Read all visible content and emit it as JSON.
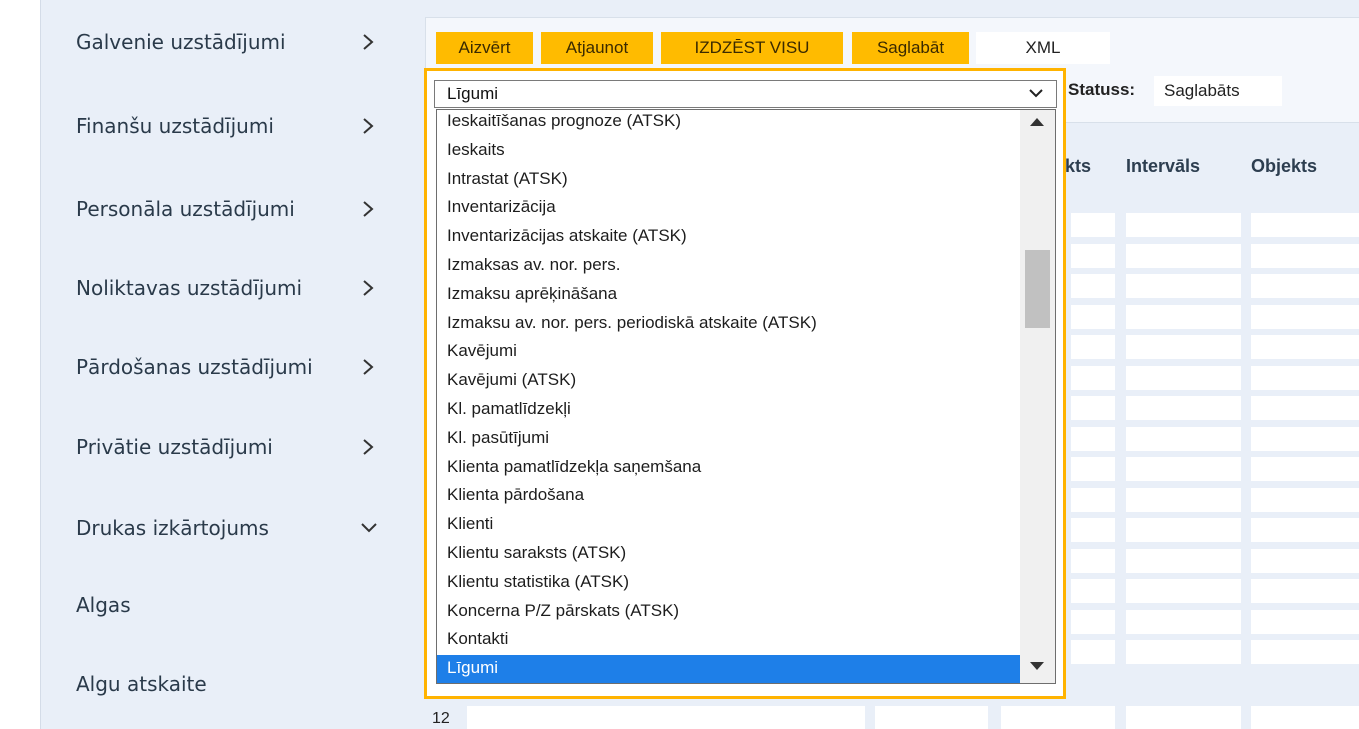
{
  "sidebar": {
    "items": [
      {
        "label": "Galvenie uzstādījumi",
        "icon": "chevron-right-icon"
      },
      {
        "label": "Finanšu uzstādījumi",
        "icon": "chevron-right-icon"
      },
      {
        "label": "Personāla uzstādījumi",
        "icon": "chevron-right-icon"
      },
      {
        "label": "Noliktavas uzstādījumi",
        "icon": "chevron-right-icon"
      },
      {
        "label": "Pārdošanas uzstādījumi",
        "icon": "chevron-right-icon"
      },
      {
        "label": "Privātie uzstādījumi",
        "icon": "chevron-right-icon"
      },
      {
        "label": "Drukas izkārtojums",
        "icon": "chevron-down-icon"
      },
      {
        "label": "Algas"
      },
      {
        "label": "Algu atskaite"
      }
    ]
  },
  "toolbar": {
    "close_label": "Aizvērt",
    "refresh_label": "Atjaunot",
    "delete_all_label": "IZDZĒST VISU",
    "save_label": "Saglabāt",
    "xml_label": "XML"
  },
  "status": {
    "label": "Statuss:",
    "value": "Saglabāts"
  },
  "table": {
    "headers": {
      "partial": "kts",
      "interval": "Intervāls",
      "object": "Objekts"
    },
    "last_row_number": "12"
  },
  "dropdown": {
    "selected_value": "Līgumi",
    "options": [
      "Ieskaitīšanas prognoze (ATSK)",
      "Ieskaits",
      "Intrastat (ATSK)",
      "Inventarizācija",
      "Inventarizācijas atskaite (ATSK)",
      "Izmaksas av. nor. pers.",
      "Izmaksu aprēķināšana",
      "Izmaksu av. nor. pers. periodiskā atskaite (ATSK)",
      "Kavējumi",
      "Kavējumi (ATSK)",
      "Kl. pamatlīdzekļi",
      "Kl. pasūtījumi",
      "Klienta pamatlīdzekļa saņemšana",
      "Klienta pārdošana",
      "Klienti",
      "Klientu saraksts (ATSK)",
      "Klientu statistika (ATSK)",
      "Koncerna P/Z pārskats (ATSK)",
      "Kontakti",
      "Līgumi"
    ],
    "selected_index": 19
  },
  "colors": {
    "accent": "#ffbb00",
    "highlight_frame": "#ffb300",
    "selection": "#1e7fe8",
    "sidebar_bg": "#e9eff8"
  }
}
